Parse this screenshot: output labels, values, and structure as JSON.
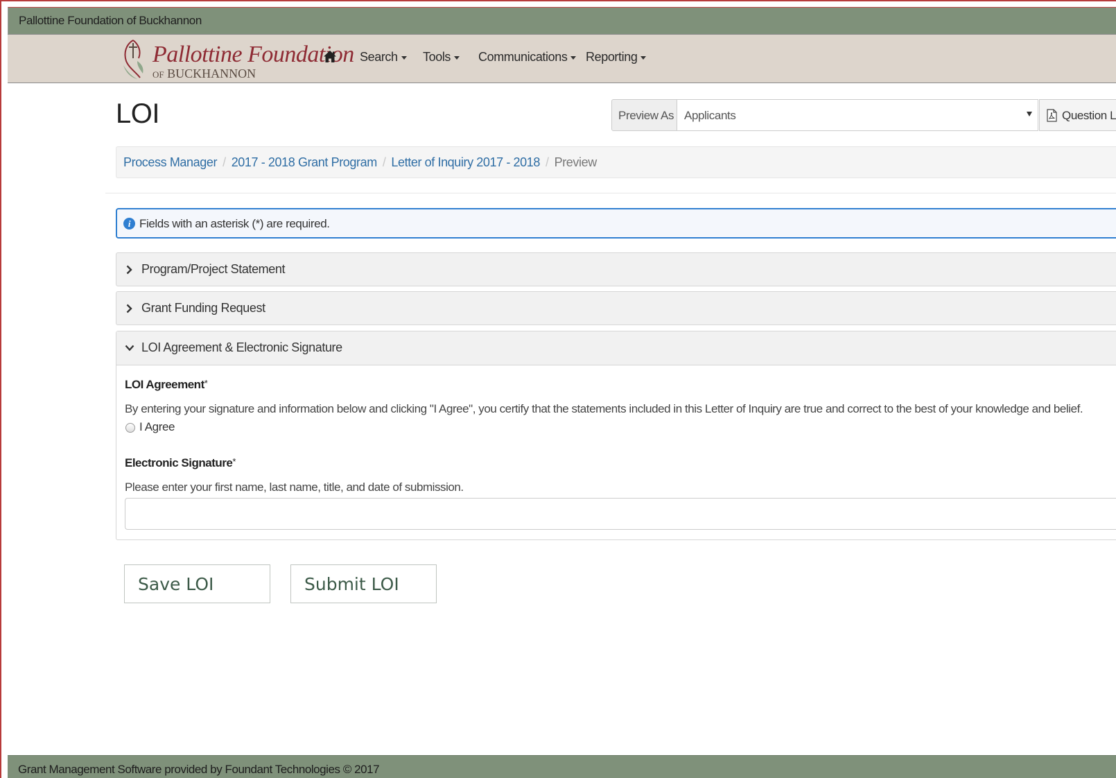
{
  "topbar": {
    "org_name": "Pallottine Foundation of Buckhannon"
  },
  "logo": {
    "line1": "Pallottine Foundation",
    "line2_prefix": "OF",
    "line2": "BUCKHANNON"
  },
  "nav": {
    "home_icon": "home-icon",
    "items": [
      {
        "label": "Search"
      },
      {
        "label": "Tools"
      },
      {
        "label": "Communications"
      },
      {
        "label": "Reporting"
      }
    ]
  },
  "page": {
    "title": "LOI"
  },
  "preview": {
    "addon_label": "Preview As",
    "selected": "Applicants",
    "question_list_label": "Question Lis"
  },
  "breadcrumb": {
    "items": [
      "Process Manager",
      "2017 - 2018 Grant Program",
      "Letter of Inquiry 2017 - 2018"
    ],
    "current": "Preview"
  },
  "alert": {
    "text": "Fields with an asterisk (*) are required."
  },
  "sections": [
    {
      "title": "Program/Project Statement",
      "expanded": false
    },
    {
      "title": "Grant Funding Request",
      "expanded": false
    },
    {
      "title": "LOI Agreement & Electronic Signature",
      "expanded": true
    }
  ],
  "agreement": {
    "label": "LOI Agreement",
    "required_mark": "*",
    "description": "By entering your signature and information below and clicking \"I Agree\", you certify that the statements included in this Letter of Inquiry are true and correct to the best of your knowledge and belief.",
    "option": "I Agree"
  },
  "signature": {
    "label": "Electronic Signature",
    "required_mark": "*",
    "description": "Please enter your first name, last name, title, and date of submission.",
    "value": ""
  },
  "buttons": {
    "save": "Save LOI",
    "submit": "Submit LOI"
  },
  "footer": {
    "text": "Grant Management Software provided by Foundant Technologies © 2017"
  },
  "colors": {
    "topbar_bg": "#7f917a",
    "navbar_bg": "#ddd5cc",
    "link": "#2e6da4",
    "alert_border": "#2f7fd1",
    "button_text": "#3c5a48"
  }
}
